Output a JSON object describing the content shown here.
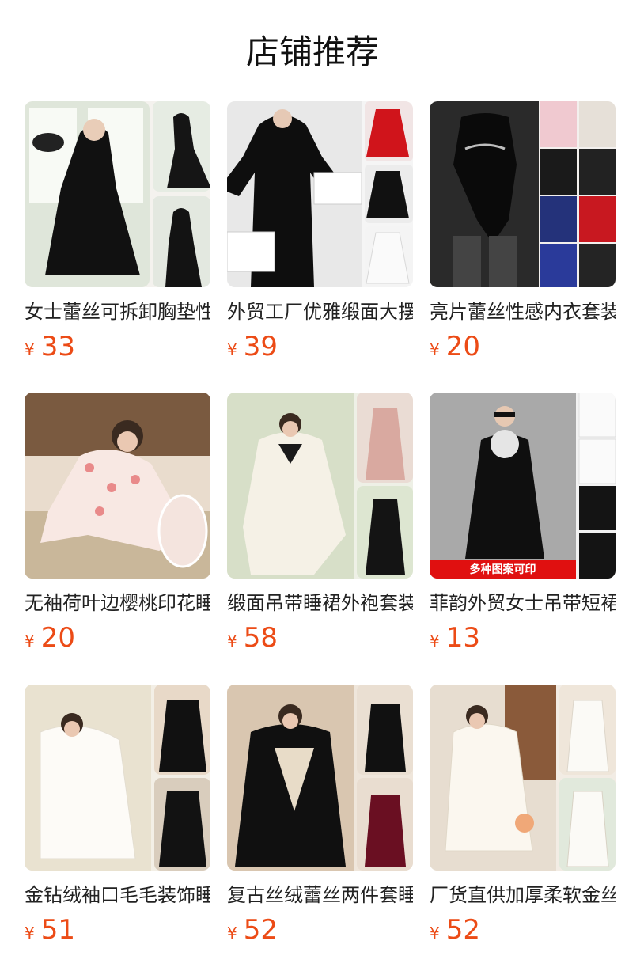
{
  "header": {
    "title": "店铺推荐"
  },
  "colors": {
    "price": "#ec4b16",
    "title": "#111111",
    "name": "#222222"
  },
  "products": [
    {
      "name": "女士蕾丝可拆卸胸垫性感睡袍",
      "currency": "¥",
      "price": "33",
      "theme": "black"
    },
    {
      "name": "外贸工厂优雅缎面大摆睡袍",
      "currency": "¥",
      "price": "39",
      "theme": "black-white"
    },
    {
      "name": "亮片蕾丝性感内衣套装",
      "currency": "¥",
      "price": "20",
      "theme": "lingerie"
    },
    {
      "name": "无袖荷叶边樱桃印花睡裙",
      "currency": "¥",
      "price": "20",
      "theme": "floral"
    },
    {
      "name": "缎面吊带睡裙外袍套装",
      "currency": "¥",
      "price": "58",
      "theme": "ivory"
    },
    {
      "name": "菲韵外贸女士吊带短裙",
      "currency": "¥",
      "price": "13",
      "theme": "print",
      "badge": "多种图案可印"
    },
    {
      "name": "金钻绒袖口毛毛装饰睡衣",
      "currency": "¥",
      "price": "51",
      "theme": "satin-white"
    },
    {
      "name": "复古丝绒蕾丝两件套睡袍",
      "currency": "¥",
      "price": "52",
      "theme": "velvet"
    },
    {
      "name": "厂货直供加厚柔软金丝绒睡衣",
      "currency": "¥",
      "price": "52",
      "theme": "cream"
    }
  ]
}
